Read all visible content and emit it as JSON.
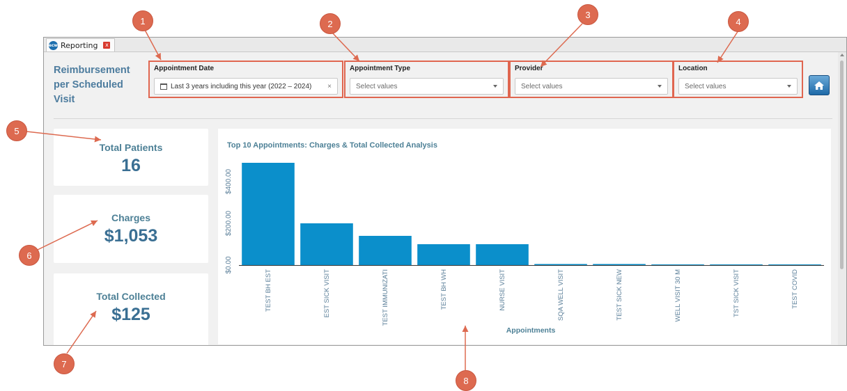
{
  "window": {
    "tab_label": "Reporting",
    "tab_logo_text": "ecw",
    "tab_close_label": "x"
  },
  "report": {
    "title_line1": "Reimbursement",
    "title_line2": "per Scheduled",
    "title_line3": "Visit"
  },
  "filters": {
    "appointment_date": {
      "label": "Appointment Date",
      "value": "Last 3 years including this year (2022 – 2024)",
      "clear": "×"
    },
    "appointment_type": {
      "label": "Appointment Type",
      "placeholder": "Select values"
    },
    "provider": {
      "label": "Provider",
      "placeholder": "Select values"
    },
    "location": {
      "label": "Location",
      "placeholder": "Select values"
    }
  },
  "kpis": {
    "total_patients": {
      "label": "Total Patients",
      "value": "16"
    },
    "charges": {
      "label": "Charges",
      "value": "$1,053"
    },
    "total_collected": {
      "label": "Total Collected",
      "value": "$125"
    }
  },
  "callouts": [
    "1",
    "2",
    "3",
    "4",
    "5",
    "6",
    "7",
    "8"
  ],
  "colors": {
    "bar": "#0b8fcb",
    "accent": "#4d8096",
    "callout": "#dd6a50",
    "filter_border": "#e06650"
  },
  "icons": {
    "home": "home-icon",
    "calendar": "calendar-icon",
    "caret": "chevron-down-icon"
  },
  "chart_data": {
    "type": "bar",
    "title": "Top 10 Appointments: Charges & Total Collected Analysis",
    "xlabel": "Appointments",
    "ylabel": "",
    "categories": [
      "TEST BH EST",
      "EST SICK VISIT",
      "TEST IMMUNIZATI",
      "TEST BH WH",
      "NURSE VISIT",
      "SQA WELL VISIT",
      "TEST SICK NEW",
      "WELL VISIT 30 M",
      "TST SICK VISIT",
      "TEST COVID"
    ],
    "values": [
      490,
      200,
      140,
      100,
      100,
      5,
      5,
      3,
      3,
      3
    ],
    "ylim": [
      0,
      520
    ],
    "yticks": [
      0,
      200,
      400
    ],
    "ytick_labels": [
      "$0.00",
      "$200.00",
      "$400.00"
    ],
    "grid": false,
    "legend": "none"
  }
}
